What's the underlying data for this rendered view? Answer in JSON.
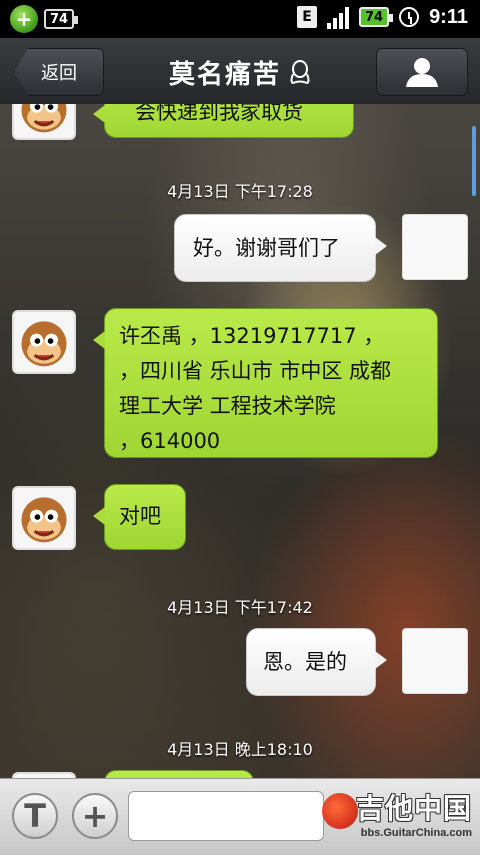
{
  "status_bar": {
    "battery_left": "74",
    "network_badge": "E",
    "battery_right": "74",
    "time": "9:11",
    "icons": [
      "add-app-icon",
      "battery-icon",
      "e-network-icon",
      "signal-icon",
      "alarm-icon"
    ]
  },
  "header": {
    "back_label": "返回",
    "title": "莫名痛苦",
    "title_icon": "qq-penguin-icon",
    "profile_icon": "person-icon"
  },
  "messages": [
    {
      "type": "in",
      "text": "会快递到我家取货"
    },
    {
      "type": "timestamp",
      "text": "4月13日 下午17:28"
    },
    {
      "type": "out",
      "text": "好。谢谢哥们了"
    },
    {
      "type": "in",
      "lines": [
        "许丕禹 ，13219717717 ，",
        "，四川省 乐山市 市中区 成都",
        "理工大学 工程技术学院",
        "，614000"
      ]
    },
    {
      "type": "in",
      "text": "对吧"
    },
    {
      "type": "timestamp",
      "text": "4月13日 下午17:42"
    },
    {
      "type": "out",
      "text": "恩。是的"
    },
    {
      "type": "timestamp",
      "text": "4月13日 晚上18:10"
    }
  ],
  "input_bar": {
    "text_button": "T",
    "plus_button": "+",
    "input_value": "",
    "watermark_title": "吉他中国",
    "watermark_sub": "bbs.GuitarChina.com"
  },
  "colors": {
    "incoming_bubble": "#a9dd3a",
    "outgoing_bubble": "#ffffff",
    "title_bar": "#2d2f33",
    "scroll_indicator": "#5aa0e0"
  }
}
